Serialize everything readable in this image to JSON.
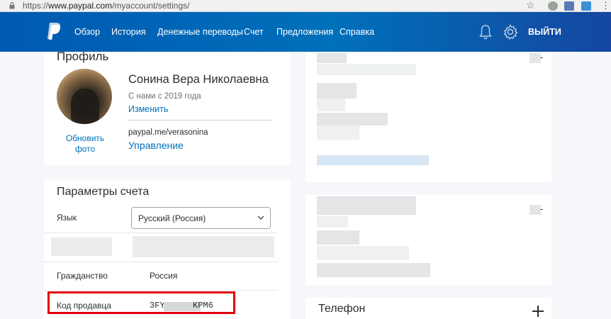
{
  "browser": {
    "url_scheme": "https://",
    "url_host": "www.paypal.com",
    "url_path": "/myaccount/settings/"
  },
  "nav": {
    "items": [
      {
        "label": "Обзор"
      },
      {
        "label": "История"
      },
      {
        "label": "Денежные переводы"
      },
      {
        "label": "Счет"
      },
      {
        "label": "Предложения"
      },
      {
        "label": "Справка"
      }
    ],
    "logout": "ВЫЙТИ",
    "icons": [
      "paypal-logo-icon",
      "bell-icon",
      "gear-icon"
    ],
    "colors": {
      "bar": "#0070ba",
      "link": "#ffffff"
    }
  },
  "profile": {
    "title": "Профиль",
    "full_name": "Сонина Вера Николаевна",
    "member_since": "С нами с 2019 года",
    "change_link": "Изменить",
    "update_photo": "Обновить фото",
    "paypal_me": "paypal.me/verasonina",
    "manage_link": "Управление"
  },
  "account": {
    "title": "Параметры счета",
    "language_label": "Язык",
    "language_value": "Русский (Россия)",
    "citizenship_label": "Гражданство",
    "citizenship_value": "Россия",
    "merchant_label": "Код продавца",
    "merchant_prefix": "3FY",
    "merchant_suffix": "KPM6",
    "highlight_color": "#e0000b"
  },
  "phone": {
    "title": "Телефон"
  },
  "colors": {
    "link": "#0070ba",
    "text": "#2c2e2f",
    "page_bg": "#f5f7fa"
  }
}
